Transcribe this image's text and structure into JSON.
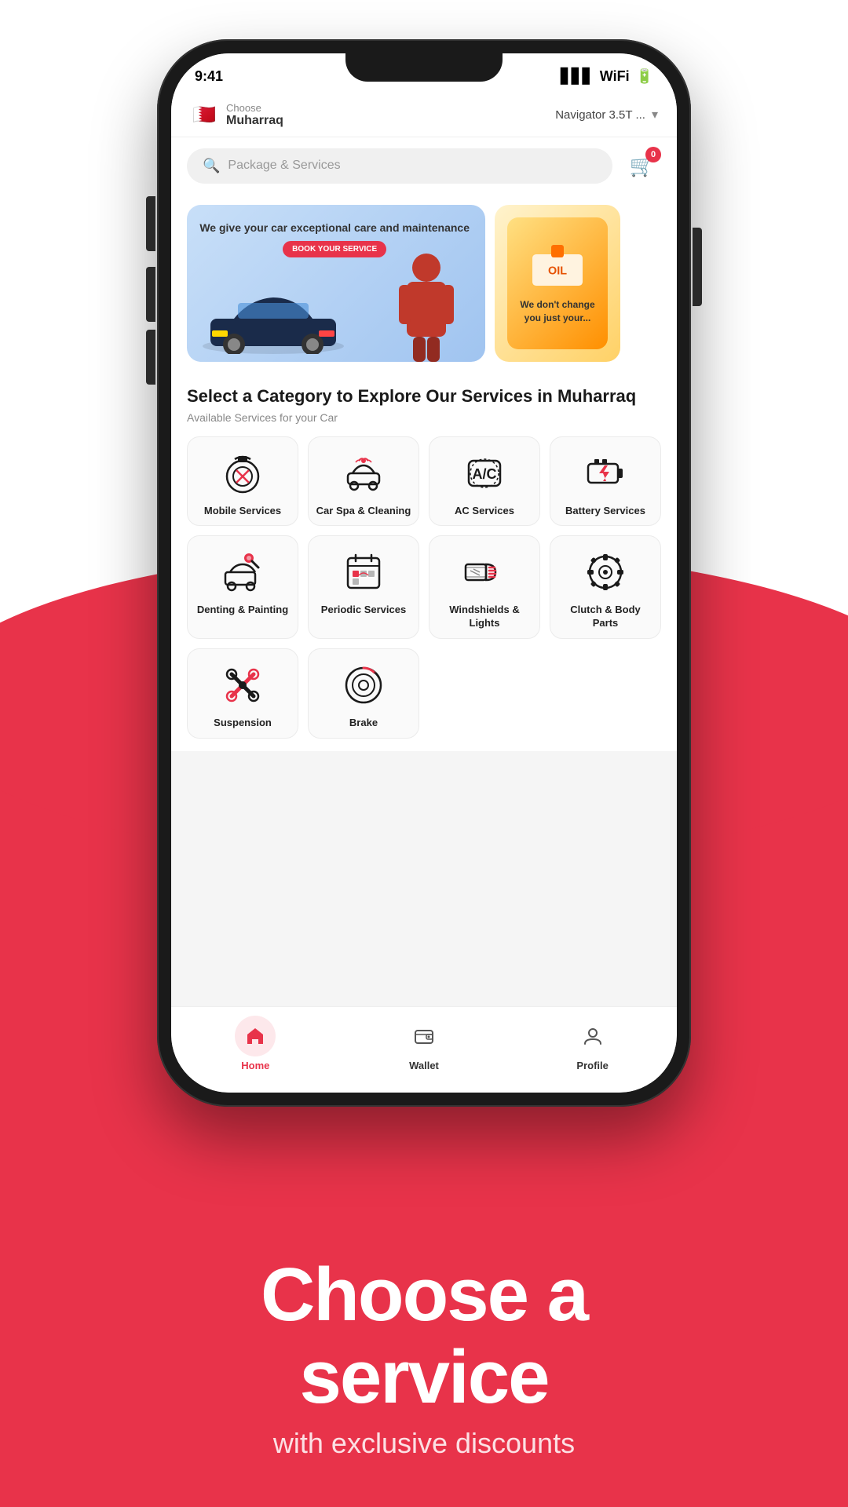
{
  "page": {
    "background_color": "#e8334a",
    "headline": "Choose a",
    "headline2": "service",
    "subheadline": "with exclusive discounts"
  },
  "status_bar": {
    "time": "9:41",
    "battery": "100%"
  },
  "header": {
    "location_choose": "Choose",
    "location_name": "Muharraq",
    "car_model": "Navigator 3.5T ...",
    "flag_emoji": "🇧🇭"
  },
  "search": {
    "placeholder": "Package & Services",
    "cart_count": "0"
  },
  "banner": {
    "main_title": "We give your car exceptional care and maintenance",
    "main_cta": "BOOK YOUR SERVICE",
    "secondary_title": "We don't change you just your..."
  },
  "categories_section": {
    "heading_line1": "Select a Category to Explore Our Services in",
    "heading_line2": "Muharraq",
    "subheading": "Available Services for your Car",
    "categories": [
      {
        "id": "mobile",
        "label": "Mobile Services",
        "icon": "mobile-services"
      },
      {
        "id": "car-spa",
        "label": "Car Spa & Cleaning",
        "icon": "car-spa"
      },
      {
        "id": "ac",
        "label": "AC Services",
        "icon": "ac-services"
      },
      {
        "id": "battery",
        "label": "Battery Services",
        "icon": "battery-services"
      },
      {
        "id": "denting",
        "label": "Denting & Painting",
        "icon": "denting-painting"
      },
      {
        "id": "periodic",
        "label": "Periodic Services",
        "icon": "periodic-services"
      },
      {
        "id": "windshield",
        "label": "Windshields & Lights",
        "icon": "windshields-lights"
      },
      {
        "id": "clutch",
        "label": "Clutch & Body Parts",
        "icon": "clutch-body"
      },
      {
        "id": "suspension",
        "label": "Suspension",
        "icon": "suspension"
      },
      {
        "id": "brake",
        "label": "Brake",
        "icon": "brake"
      }
    ]
  },
  "bottom_nav": {
    "items": [
      {
        "id": "home",
        "label": "Home",
        "active": true
      },
      {
        "id": "wallet",
        "label": "Wallet",
        "active": false
      },
      {
        "id": "profile",
        "label": "Profile",
        "active": false
      }
    ]
  }
}
